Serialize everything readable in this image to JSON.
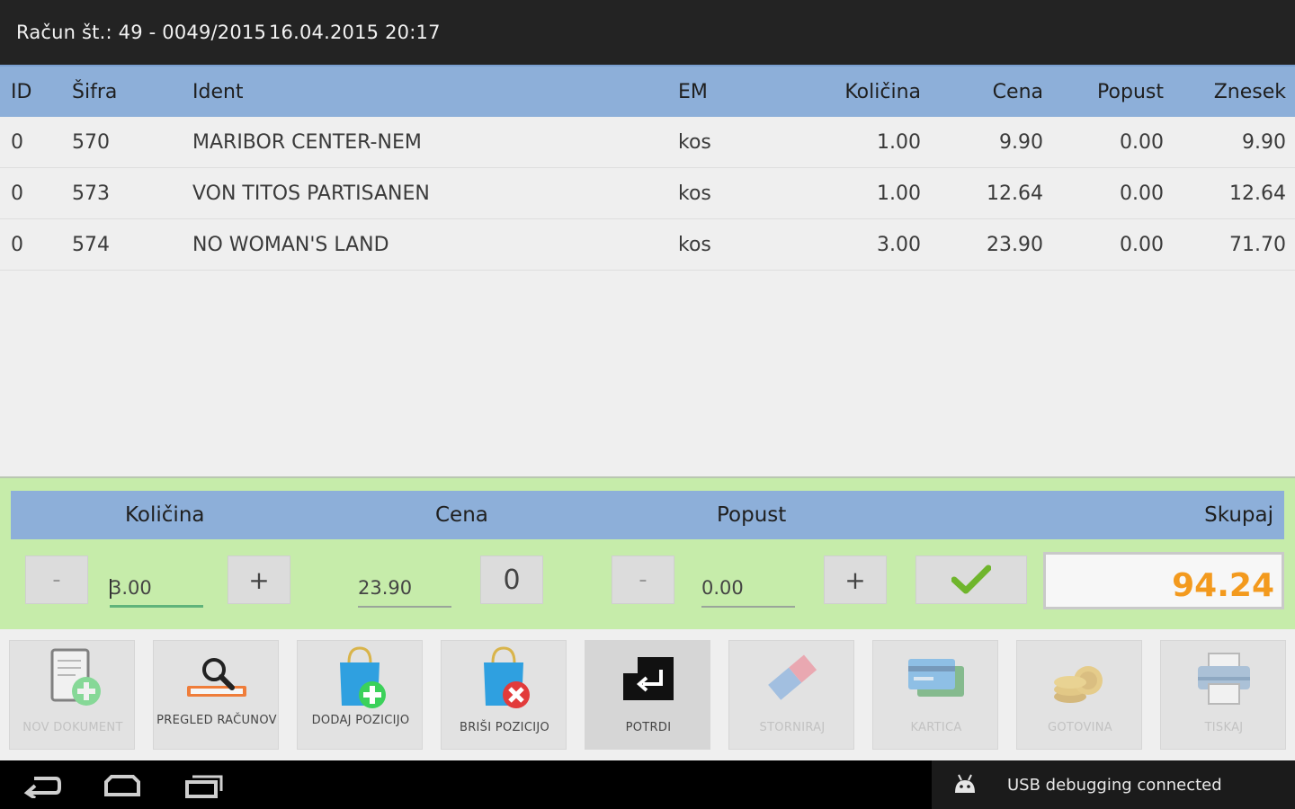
{
  "title_bar": {
    "invoice": "Račun št.: 49 - 0049/2015",
    "datetime": "16.04.2015 20:17"
  },
  "table": {
    "columns": [
      "ID",
      "Šifra",
      "Ident",
      "EM",
      "Količina",
      "Cena",
      "Popust",
      "Znesek"
    ],
    "rows": [
      {
        "id": "0",
        "sifra": "570",
        "ident": "MARIBOR CENTER-NEM",
        "em": "kos",
        "kolicina": "1.00",
        "cena": "9.90",
        "popust": "0.00",
        "znesek": "9.90"
      },
      {
        "id": "0",
        "sifra": "573",
        "ident": "VON TITOS PARTISANEN",
        "em": "kos",
        "kolicina": "1.00",
        "cena": "12.64",
        "popust": "0.00",
        "znesek": "12.64"
      },
      {
        "id": "0",
        "sifra": "574",
        "ident": "NO WOMAN'S LAND",
        "em": "kos",
        "kolicina": "3.00",
        "cena": "23.90",
        "popust": "0.00",
        "znesek": "71.70"
      }
    ]
  },
  "edit_panel": {
    "headers": {
      "kolicina": "Količina",
      "cena": "Cena",
      "popust": "Popust",
      "skupaj": "Skupaj"
    },
    "minus_label": "-",
    "plus_label": "+",
    "quantity_value": "3.00",
    "price_value": "23.90",
    "zero_button": "0",
    "discount_value": "0.00",
    "total": "94.24",
    "accent_color": "#f39a1e"
  },
  "toolbar": {
    "buttons": [
      {
        "label": "NOV DOKUMENT",
        "icon": "new-document-icon",
        "enabled": false
      },
      {
        "label": "PREGLED RAČUNOV",
        "icon": "search-receipts-icon",
        "enabled": true
      },
      {
        "label": "DODAJ POZICIJO",
        "icon": "add-item-bag-icon",
        "enabled": true
      },
      {
        "label": "BRIŠI POZICIJO",
        "icon": "delete-item-bag-icon",
        "enabled": true
      },
      {
        "label": "POTRDI",
        "icon": "enter-icon",
        "enabled": true
      },
      {
        "label": "STORNIRAJ",
        "icon": "eraser-icon",
        "enabled": false
      },
      {
        "label": "KARTICA",
        "icon": "credit-card-icon",
        "enabled": false
      },
      {
        "label": "GOTOVINA",
        "icon": "coins-icon",
        "enabled": false
      },
      {
        "label": "TISKAJ",
        "icon": "printer-icon",
        "enabled": false
      }
    ]
  },
  "system_bar": {
    "status_text": "USB debugging connected",
    "nav_icons": [
      "back-icon",
      "home-icon",
      "recent-apps-icon"
    ],
    "status_icon": "android-debug-icon"
  }
}
